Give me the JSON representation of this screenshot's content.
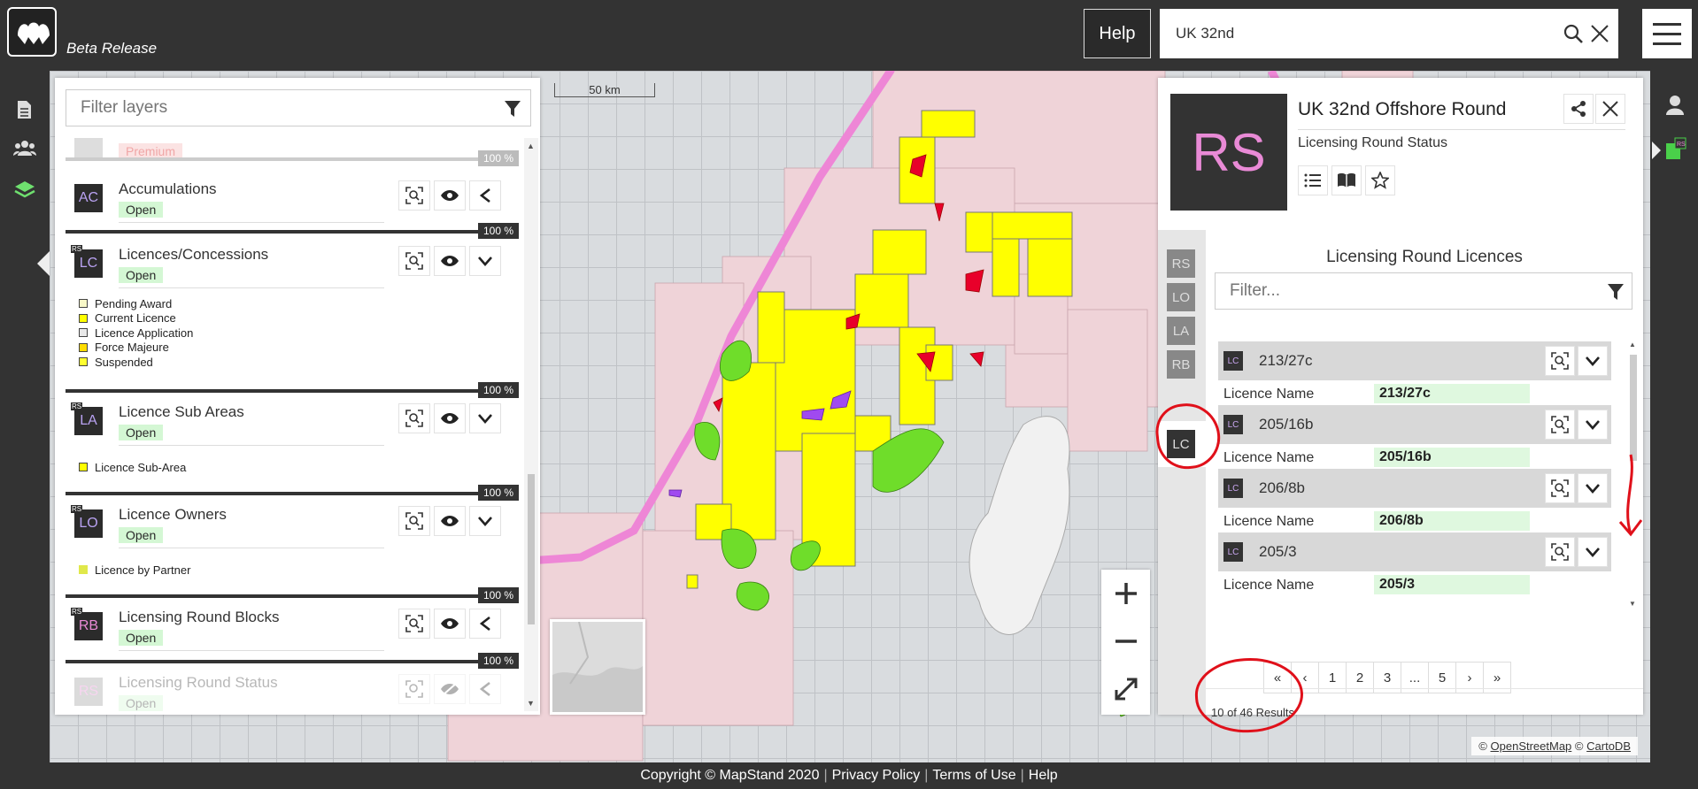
{
  "header": {
    "beta_label": "Beta Release",
    "help_label": "Help",
    "search_value": "UK 32nd"
  },
  "map": {
    "scale_label": "50 km",
    "attribution": {
      "prefix": "©",
      "osm": "OpenStreetMap",
      "mid": "©",
      "carto": "CartoDB"
    }
  },
  "layers_panel": {
    "filter_placeholder": "Filter layers",
    "items": [
      {
        "badge": "",
        "name": "",
        "status": "Premium",
        "pct": "100 %"
      },
      {
        "badge": "AC",
        "name": "Accumulations",
        "status": "Open",
        "pct": "100 %",
        "rs": false
      },
      {
        "badge": "LC",
        "name": "Licences/Concessions",
        "status": "Open",
        "pct": "100 %",
        "rs": true,
        "legend": [
          "Pending Award",
          "Current Licence",
          "Licence Application",
          "Force Majeure",
          "Suspended"
        ]
      },
      {
        "badge": "LA",
        "name": "Licence Sub Areas",
        "status": "Open",
        "pct": "100 %",
        "rs": true,
        "legend": [
          "Licence Sub-Area"
        ]
      },
      {
        "badge": "LO",
        "name": "Licence Owners",
        "status": "Open",
        "pct": "100 %",
        "rs": true,
        "legend": [
          "Licence by Partner"
        ]
      },
      {
        "badge": "RB",
        "name": "Licensing Round Blocks",
        "status": "Open",
        "pct": "100 %",
        "rs": true
      },
      {
        "badge": "RS",
        "name": "Licensing Round Status",
        "status": "Open",
        "pct": "100 %"
      }
    ],
    "rs_mini": "RS"
  },
  "detail_panel": {
    "badge": "RS",
    "title": "UK 32nd Offshore Round",
    "subtitle": "Licensing Round Status",
    "side_tabs": [
      "RS",
      "LO",
      "LA",
      "RB",
      "LC"
    ],
    "section_title": "Licensing Round Licences",
    "filter_placeholder": "Filter...",
    "field_label": "Licence Name",
    "card_badge": "LC",
    "licences": [
      {
        "code": "213/27c",
        "name": "213/27c"
      },
      {
        "code": "205/16b",
        "name": "205/16b"
      },
      {
        "code": "206/8b",
        "name": "206/8b"
      },
      {
        "code": "205/3",
        "name": "205/3"
      }
    ],
    "pager": [
      "«",
      "‹",
      "1",
      "2",
      "3",
      "...",
      "5",
      "›",
      "»"
    ],
    "results": "10 of 46 Results"
  },
  "footer": {
    "copyright": "Copyright © MapStand 2020",
    "privacy": "Privacy Policy",
    "terms": "Terms of Use",
    "help": "Help"
  },
  "colors": {
    "accent_pink": "#e98ad6",
    "licence_yellow": "#ffff00",
    "block_pink": "#efd3d8",
    "status_green": "#d4f7d4",
    "annotation_red": "#e0101a"
  }
}
